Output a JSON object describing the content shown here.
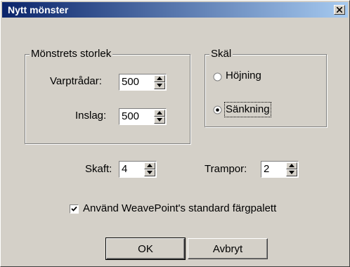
{
  "dialog": {
    "title": "Nytt mönster",
    "close_icon": "close-x-icon"
  },
  "size_group": {
    "legend": "Mönstrets storlek",
    "warp_label": "Varptrådar:",
    "warp_value": "500",
    "weft_label": "Inslag:",
    "weft_value": "500"
  },
  "shed_group": {
    "legend": "Skäl",
    "options": [
      "Höjning",
      "Sänkning"
    ],
    "selected": "Sänkning"
  },
  "shafts": {
    "label": "Skaft:",
    "value": "4"
  },
  "treadles": {
    "label": "Trampor:",
    "value": "2"
  },
  "palette_checkbox": {
    "label": "Använd WeavePoint's standard färgpalett",
    "checked": true
  },
  "buttons": {
    "ok": "OK",
    "cancel": "Avbryt"
  }
}
